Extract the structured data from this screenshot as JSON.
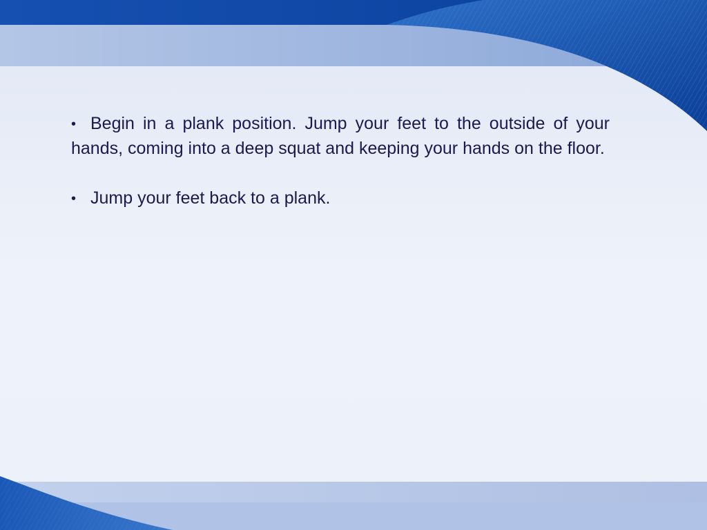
{
  "slide": {
    "bullet_symbol": "•",
    "bullets": [
      {
        "text": "Begin in a plank position. Jump your feet to the outside of your hands, coming into a deep squat and keeping your hands on the floor."
      },
      {
        "text": "Jump your feet back to a plank."
      }
    ]
  },
  "theme": {
    "primary_blue": "#0f4fa8",
    "dark_blue": "#0a3a8a",
    "light_band": "#a9bfe2",
    "content_background": "#eef2fa",
    "text_color": "#1a1a4e"
  }
}
